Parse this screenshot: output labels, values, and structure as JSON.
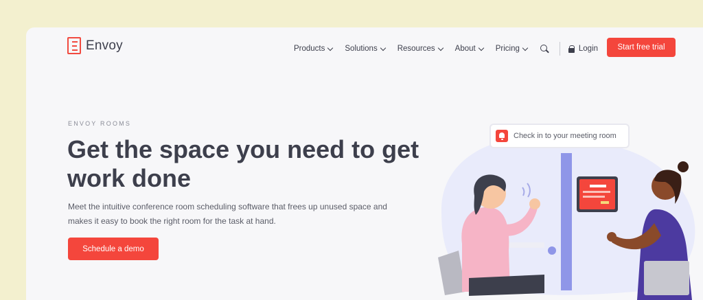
{
  "brand": {
    "name": "Envoy",
    "accent": "#f4463c"
  },
  "nav": {
    "items": [
      {
        "label": "Products"
      },
      {
        "label": "Solutions"
      },
      {
        "label": "Resources"
      },
      {
        "label": "About"
      },
      {
        "label": "Pricing"
      }
    ],
    "search_icon": "search-icon",
    "login_label": "Login",
    "trial_label": "Start free trial"
  },
  "hero": {
    "eyebrow": "ENVOY ROOMS",
    "headline": "Get the space you need to get work done",
    "subcopy": "Meet the intuitive conference room scheduling software that frees up unused space and makes it easy to book the right room for the task at hand.",
    "cta_label": "Schedule a demo"
  },
  "illustration": {
    "toast_text": "Check in to your meeting room",
    "toast_icon": "bell-icon"
  }
}
